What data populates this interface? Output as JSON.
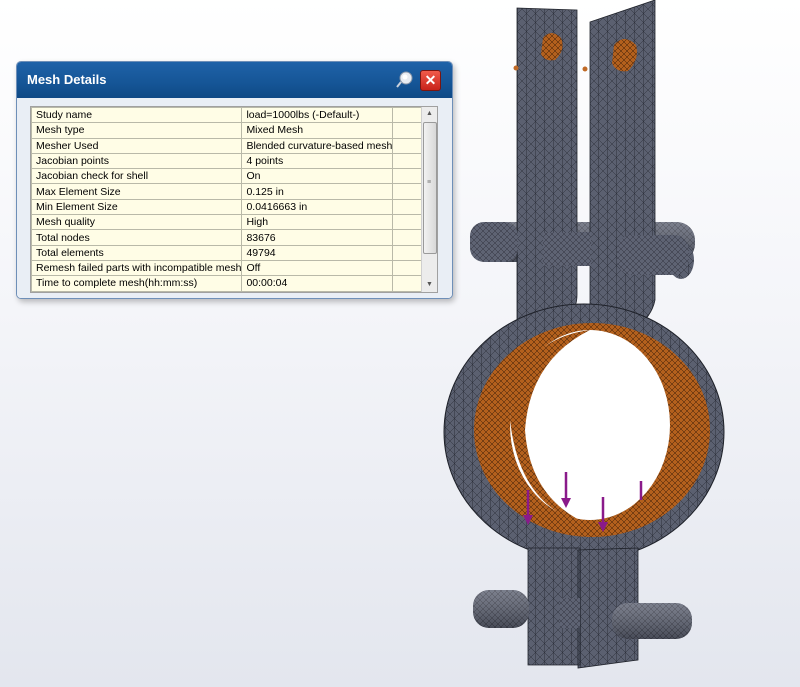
{
  "dialog": {
    "title": "Mesh Details",
    "close_label": "✕"
  },
  "rows": [
    {
      "key": "Study name",
      "value": "load=1000lbs (-Default-)"
    },
    {
      "key": "Mesh type",
      "value": "Mixed Mesh"
    },
    {
      "key": "Mesher Used",
      "value": "Blended curvature-based mesh"
    },
    {
      "key": "Jacobian points",
      "value": "4 points"
    },
    {
      "key": "Jacobian check for shell",
      "value": "On"
    },
    {
      "key": "Max Element Size",
      "value": "0.125 in"
    },
    {
      "key": "Min Element Size",
      "value": "0.0416663 in"
    },
    {
      "key": "Mesh quality",
      "value": "High"
    },
    {
      "key": "Total nodes",
      "value": "83676"
    },
    {
      "key": "Total elements",
      "value": "49794"
    },
    {
      "key": "Remesh failed parts with incompatible mesh",
      "value": "Off"
    },
    {
      "key": "Time to complete mesh(hh:mm:ss)",
      "value": "00:00:04"
    }
  ],
  "colors": {
    "mesh_gray": "#5a5f6e",
    "mesh_orange": "#b8621c",
    "load_arrow": "#8a1a8a",
    "titlebar": "#155596"
  },
  "icons": {
    "pin": "pushpin-icon",
    "close": "close-icon"
  }
}
